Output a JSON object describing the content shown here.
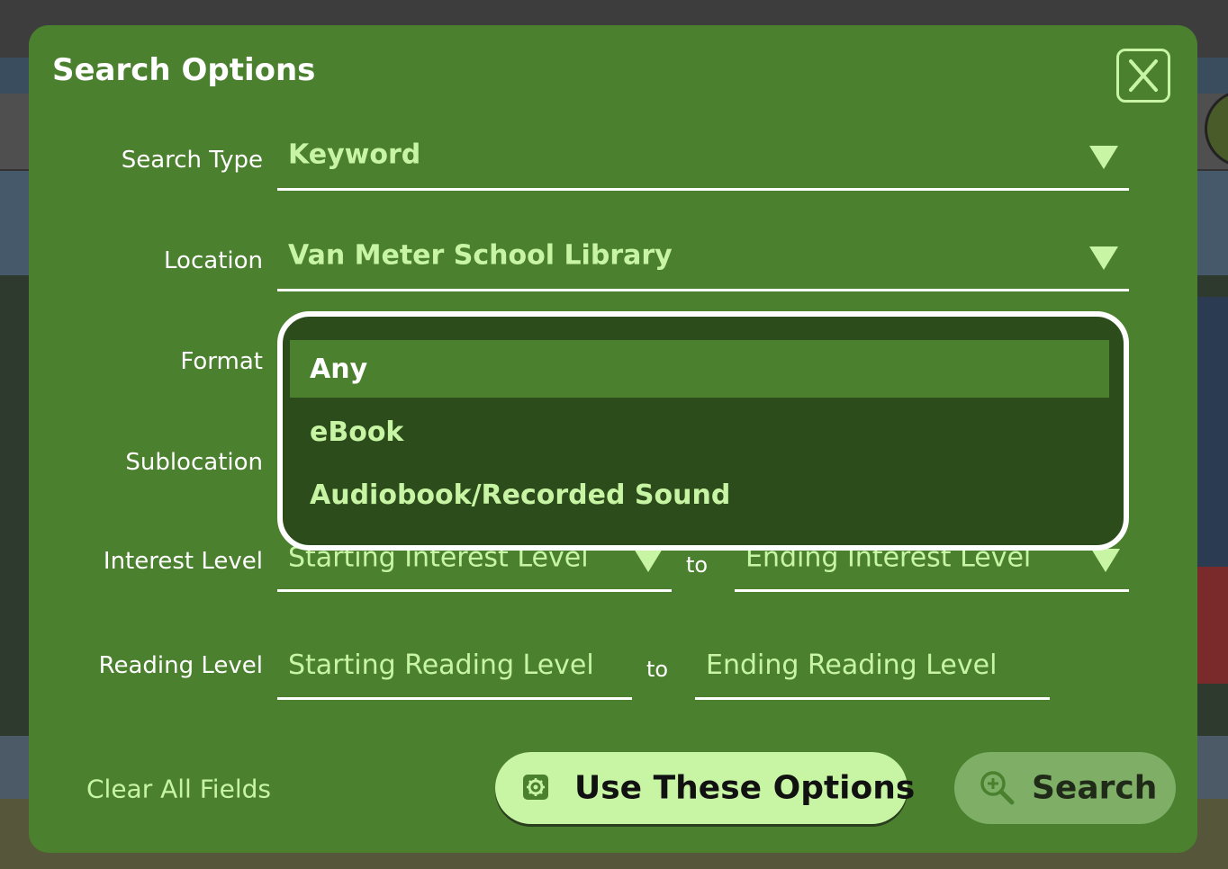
{
  "modal": {
    "title": "Search Options",
    "close_label": "X"
  },
  "fields": {
    "search_type": {
      "label": "Search Type",
      "value": "Keyword"
    },
    "location": {
      "label": "Location",
      "value": "Van Meter School Library"
    },
    "format": {
      "label": "Format"
    },
    "sublocation": {
      "label": "Sublocation"
    },
    "interest_level": {
      "label": "Interest Level",
      "start_value": "Starting Interest Level",
      "end_value": "Ending Interest Level",
      "to_label": "to"
    },
    "reading_level": {
      "label": "Reading Level",
      "start_placeholder": "Starting Reading Level",
      "end_placeholder": "Ending Reading Level",
      "to_label": "to"
    }
  },
  "format_dropdown": {
    "options": [
      "Any",
      "eBook",
      "Audiobook/Recorded Sound"
    ],
    "selected": "Any"
  },
  "actions": {
    "clear_label": "Clear All Fields",
    "use_options_label": "Use These Options",
    "search_label": "Search"
  },
  "colors": {
    "modal_bg": "#4b802f",
    "accent": "#c8f5a4",
    "dropdown_bg": "#2c4c1b"
  }
}
